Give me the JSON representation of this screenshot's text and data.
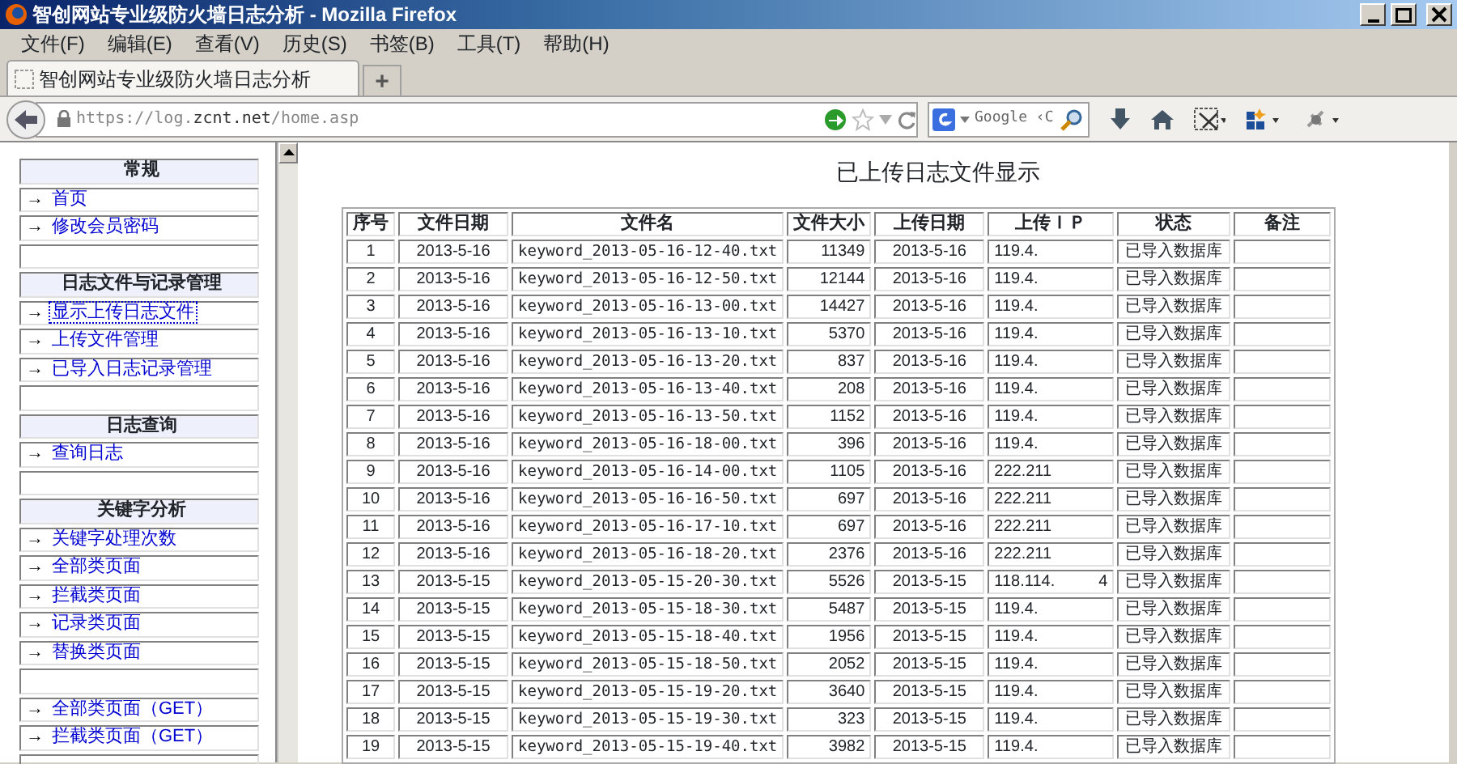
{
  "window": {
    "title": "智创网站专业级防火墙日志分析 - Mozilla Firefox"
  },
  "menu": [
    "文件(F)",
    "编辑(E)",
    "查看(V)",
    "历史(S)",
    "书签(B)",
    "工具(T)",
    "帮助(H)"
  ],
  "tabs": [
    {
      "label": "智创网站专业级防火墙日志分析",
      "selected": true
    }
  ],
  "new_tab": "+",
  "address": {
    "scheme": "https://log.",
    "domain": "zcnt.net",
    "path": "/home.asp"
  },
  "search": {
    "placeholder": "Google ‹C"
  },
  "sidebar": {
    "sections": [
      {
        "title": "常规",
        "items": [
          {
            "arrow": "→",
            "label": "首页",
            "selected": false
          },
          {
            "arrow": "→",
            "label": "修改会员密码",
            "selected": false
          }
        ]
      },
      {
        "title": "日志文件与记录管理",
        "items": [
          {
            "arrow": "→",
            "label": "显示上传日志文件",
            "selected": true
          },
          {
            "arrow": "→",
            "label": "上传文件管理",
            "selected": false
          },
          {
            "arrow": "→",
            "label": "已导入日志记录管理",
            "selected": false
          }
        ]
      },
      {
        "title": "日志查询",
        "items": [
          {
            "arrow": "→",
            "label": "查询日志",
            "selected": false
          }
        ]
      },
      {
        "title": "关键字分析",
        "items": [
          {
            "arrow": "→",
            "label": "关键字处理次数",
            "selected": false
          },
          {
            "arrow": "→",
            "label": "全部类页面",
            "selected": false
          },
          {
            "arrow": "→",
            "label": "拦截类页面",
            "selected": false
          },
          {
            "arrow": "→",
            "label": "记录类页面",
            "selected": false
          },
          {
            "arrow": "→",
            "label": "替换类页面",
            "selected": false
          }
        ]
      },
      {
        "items": [
          {
            "arrow": "→",
            "label": "全部类页面（GET）",
            "selected": false
          },
          {
            "arrow": "→",
            "label": "拦截类页面（GET）",
            "selected": false
          }
        ]
      }
    ]
  },
  "page_title": "已上传日志文件显示",
  "table": {
    "columns": [
      "序号",
      "文件日期",
      "文件名",
      "文件大小",
      "上传日期",
      "上传ＩＰ",
      "状态",
      "备注"
    ],
    "rows": [
      [
        "1",
        "2013-5-16",
        "keyword_2013-05-16-12-40.txt",
        "11349",
        "2013-5-16",
        "119.4.",
        "已导入数据库"
      ],
      [
        "2",
        "2013-5-16",
        "keyword_2013-05-16-12-50.txt",
        "12144",
        "2013-5-16",
        "119.4.",
        "已导入数据库"
      ],
      [
        "3",
        "2013-5-16",
        "keyword_2013-05-16-13-00.txt",
        "14427",
        "2013-5-16",
        "119.4.",
        "已导入数据库"
      ],
      [
        "4",
        "2013-5-16",
        "keyword_2013-05-16-13-10.txt",
        "5370",
        "2013-5-16",
        "119.4.",
        "已导入数据库"
      ],
      [
        "5",
        "2013-5-16",
        "keyword_2013-05-16-13-20.txt",
        "837",
        "2013-5-16",
        "119.4.",
        "已导入数据库"
      ],
      [
        "6",
        "2013-5-16",
        "keyword_2013-05-16-13-40.txt",
        "208",
        "2013-5-16",
        "119.4.",
        "已导入数据库"
      ],
      [
        "7",
        "2013-5-16",
        "keyword_2013-05-16-13-50.txt",
        "1152",
        "2013-5-16",
        "119.4.",
        "已导入数据库"
      ],
      [
        "8",
        "2013-5-16",
        "keyword_2013-05-16-18-00.txt",
        "396",
        "2013-5-16",
        "119.4.",
        "已导入数据库"
      ],
      [
        "9",
        "2013-5-16",
        "keyword_2013-05-16-14-00.txt",
        "1105",
        "2013-5-16",
        "222.211",
        "已导入数据库"
      ],
      [
        "10",
        "2013-5-16",
        "keyword_2013-05-16-16-50.txt",
        "697",
        "2013-5-16",
        "222.211",
        "已导入数据库"
      ],
      [
        "11",
        "2013-5-16",
        "keyword_2013-05-16-17-10.txt",
        "697",
        "2013-5-16",
        "222.211",
        "已导入数据库"
      ],
      [
        "12",
        "2013-5-16",
        "keyword_2013-05-16-18-20.txt",
        "2376",
        "2013-5-16",
        "222.211",
        "已导入数据库"
      ],
      {
        "cells": [
          "13",
          "2013-5-15",
          "keyword_2013-05-15-20-30.txt",
          "5526",
          "2013-5-15",
          "118.114.",
          "已导入数据库"
        ],
        "ip_tail": "4"
      },
      [
        "14",
        "2013-5-15",
        "keyword_2013-05-15-18-30.txt",
        "5487",
        "2013-5-15",
        "119.4.",
        "已导入数据库"
      ],
      [
        "15",
        "2013-5-15",
        "keyword_2013-05-15-18-40.txt",
        "1956",
        "2013-5-15",
        "119.4.",
        "已导入数据库"
      ],
      [
        "16",
        "2013-5-15",
        "keyword_2013-05-15-18-50.txt",
        "2052",
        "2013-5-15",
        "119.4.",
        "已导入数据库"
      ],
      [
        "17",
        "2013-5-15",
        "keyword_2013-05-15-19-20.txt",
        "3640",
        "2013-5-15",
        "119.4.",
        "已导入数据库"
      ],
      [
        "18",
        "2013-5-15",
        "keyword_2013-05-15-19-30.txt",
        "323",
        "2013-5-15",
        "119.4.",
        "已导入数据库"
      ],
      [
        "19",
        "2013-5-15",
        "keyword_2013-05-15-19-40.txt",
        "3982",
        "2013-5-15",
        "119.4.",
        "已导入数据库"
      ]
    ]
  }
}
